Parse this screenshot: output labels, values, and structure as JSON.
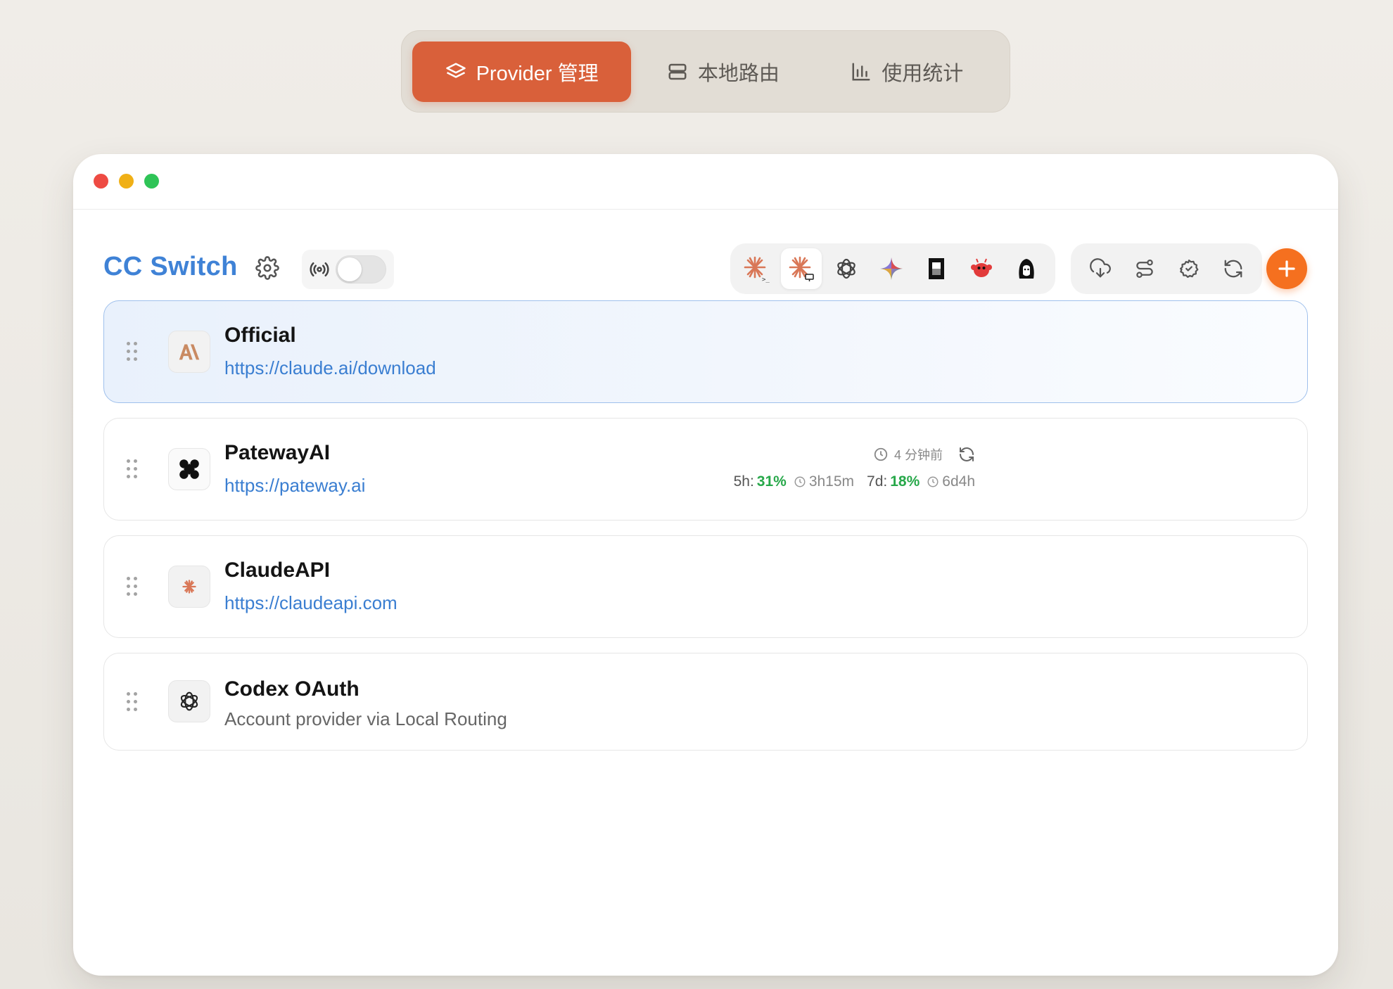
{
  "topnav": {
    "tabs": [
      {
        "label": "Provider 管理",
        "active": true
      },
      {
        "label": "本地路由",
        "active": false
      },
      {
        "label": "使用统计",
        "active": false
      }
    ]
  },
  "header": {
    "title": "CC Switch",
    "apps": [
      {
        "name": "claude-code",
        "selected": false
      },
      {
        "name": "claude-desktop",
        "selected": true
      },
      {
        "name": "codex",
        "selected": false
      },
      {
        "name": "gemini",
        "selected": false
      },
      {
        "name": "opencode",
        "selected": false
      },
      {
        "name": "openclaw",
        "selected": false
      },
      {
        "name": "hermes",
        "selected": false
      }
    ],
    "tools": [
      "cloud-download-icon",
      "route-icon",
      "badge-check-icon",
      "refresh-icon"
    ]
  },
  "providers": [
    {
      "name": "Official",
      "url": "https://claude.ai/download",
      "active": true,
      "logo": "anthropic"
    },
    {
      "name": "PatewayAI",
      "url": "https://pateway.ai",
      "active": false,
      "logo": "pateway",
      "usage": {
        "updated": "4 分钟前",
        "h5_label": "5h:",
        "h5_pct": "31%",
        "h5_reset": "3h15m",
        "d7_label": "7d:",
        "d7_pct": "18%",
        "d7_reset": "6d4h"
      }
    },
    {
      "name": "ClaudeAPI",
      "url": "https://claudeapi.com",
      "active": false,
      "logo": "claude"
    },
    {
      "name": "Codex OAuth",
      "desc": "Account provider via Local Routing",
      "active": false,
      "logo": "openai"
    }
  ],
  "colors": {
    "accent": "#d9603a",
    "brand_blue": "#3f82d6",
    "add": "#f5701f",
    "green": "#27a84a"
  }
}
